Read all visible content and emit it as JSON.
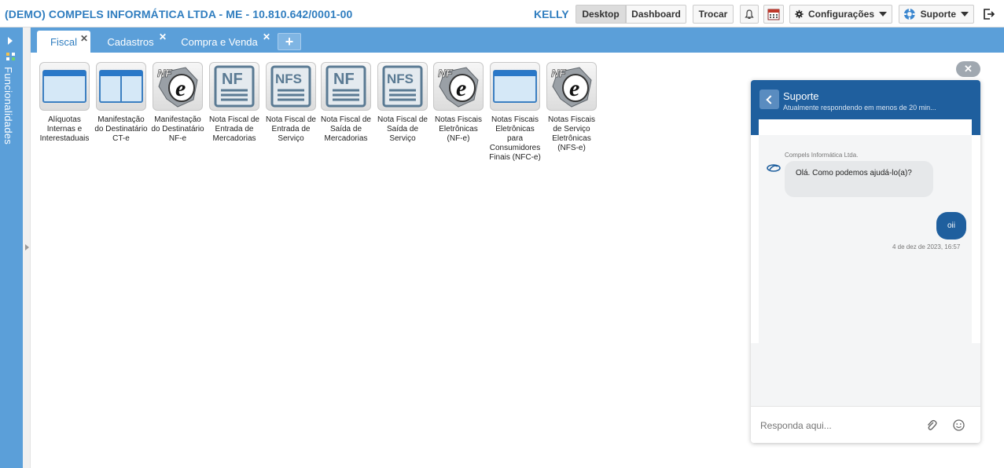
{
  "topbar": {
    "company": "(DEMO) COMPELS INFORMÁTICA LTDA - ME - 10.810.642/0001-00",
    "user": "KELLY",
    "desktop": "Desktop",
    "dashboard": "Dashboard",
    "trocar": "Trocar",
    "config": "Configurações",
    "suporte": "Suporte"
  },
  "sidebar": {
    "label": "Funcionalidades"
  },
  "tabs": [
    {
      "label": "Fiscal"
    },
    {
      "label": "Cadastros"
    },
    {
      "label": "Compra e Venda"
    }
  ],
  "apps": [
    {
      "label": "Alíquotas Internas e Interestaduais",
      "icon": "window"
    },
    {
      "label": "Manifestação do Destinatário CT-e",
      "icon": "window-split"
    },
    {
      "label": "Manifestação do Destinatário NF-e",
      "icon": "nfe"
    },
    {
      "label": "Nota Fiscal de Entrada de Mercadorias",
      "icon": "NF"
    },
    {
      "label": "Nota Fiscal de Entrada de Serviço",
      "icon": "NFS"
    },
    {
      "label": "Nota Fiscal de Saída de Mercadorias",
      "icon": "NF"
    },
    {
      "label": "Nota Fiscal de Saída de Serviço",
      "icon": "NFS"
    },
    {
      "label": "Notas Fiscais Eletrônicas (NF-e)",
      "icon": "nfe"
    },
    {
      "label": "Notas Fiscais Eletrônicas para Consumidores Finais (NFC-e)",
      "icon": "window"
    },
    {
      "label": "Notas Fiscais de Serviço Eletrônicas (NFS-e)",
      "icon": "nfe"
    }
  ],
  "chat": {
    "title": "Suporte",
    "subtitle": "Atualmente respondendo em menos de 20 min...",
    "agent_name": "Compels Informática Ltda.",
    "incoming": "Olá. Como podemos ajudá-lo(a)?",
    "outgoing": "oii",
    "timestamp": "4 de dez de 2023, 16:57",
    "placeholder": "Responda aqui..."
  },
  "colors": {
    "brand": "#2f7dbf",
    "bar": "#5b9fd9",
    "chat_header": "#1f5f9e"
  }
}
